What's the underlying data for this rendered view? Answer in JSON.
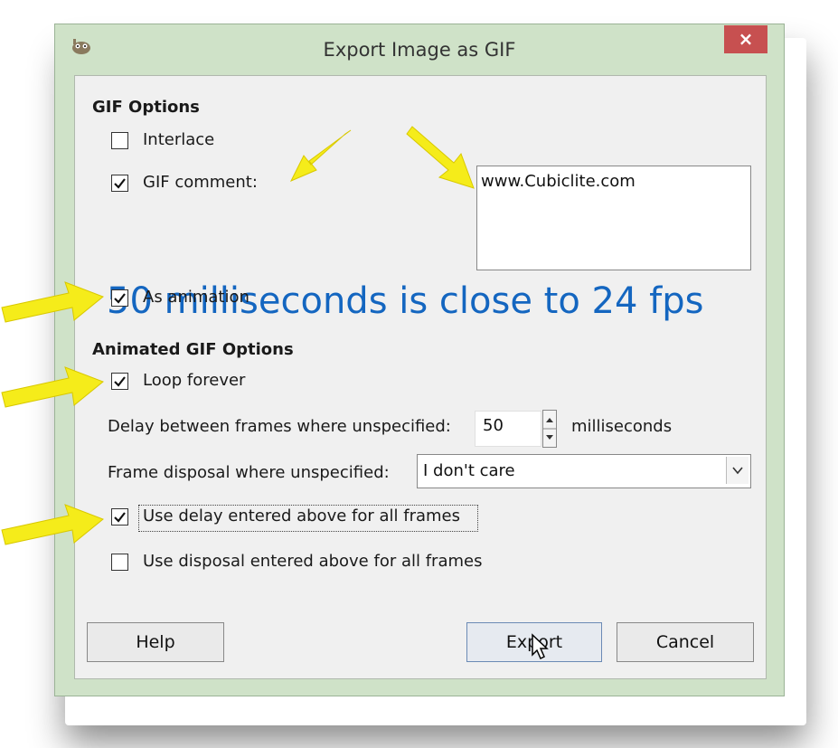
{
  "window": {
    "title": "Export Image as GIF",
    "close_glyph": "×",
    "icon": "gimp-icon"
  },
  "gif_options": {
    "heading": "GIF Options",
    "interlace": {
      "label": "Interlace",
      "checked": false
    },
    "gif_comment": {
      "label": "GIF comment:",
      "checked": true
    },
    "comment_value": "www.Cubiclite.com"
  },
  "overlay_caption": "50 milliseconds is close to 24 fps",
  "as_animation": {
    "label": "As animation",
    "checked": true
  },
  "animated_options": {
    "heading": "Animated GIF Options",
    "loop_forever": {
      "label": "Loop forever",
      "checked": true
    },
    "delay_label": "Delay between frames where unspecified:",
    "delay_value": "50",
    "delay_unit": "milliseconds",
    "disposal_label": "Frame disposal where unspecified:",
    "disposal_value": "I don't care",
    "use_delay_all": {
      "label": "Use delay entered above for all frames",
      "checked": true
    },
    "use_disposal_all": {
      "label": "Use disposal entered above for all frames",
      "checked": false
    }
  },
  "buttons": {
    "help": "Help",
    "export": "Export",
    "cancel": "Cancel"
  },
  "colors": {
    "annotation_arrow": "#f5ec1a",
    "caption_text": "#1466c0",
    "close_button": "#c75050"
  }
}
